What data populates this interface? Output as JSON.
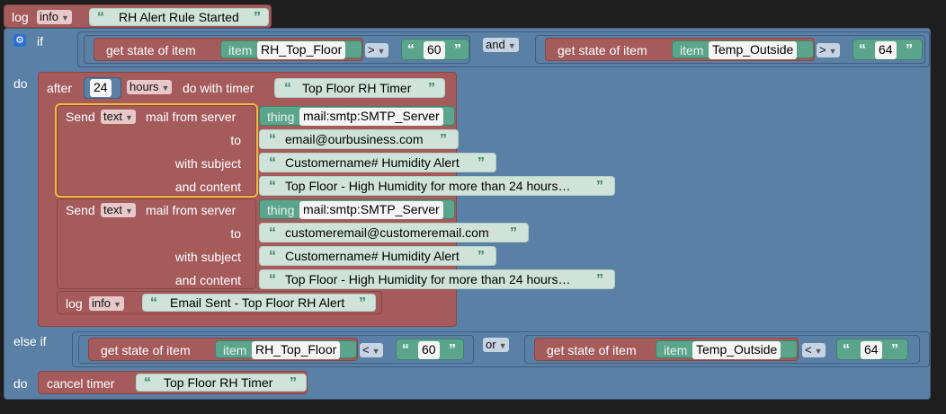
{
  "log1": {
    "label": "log",
    "level": "info",
    "text": "RH Alert Rule Started"
  },
  "if_block": {
    "if_label": "if",
    "else_if_label": "else if",
    "do_label": "do",
    "condition1": {
      "left": {
        "get_label": "get state of item",
        "item_label": "item",
        "item_name": "RH_Top_Floor",
        "op": ">",
        "value": "60"
      },
      "joiner": "and",
      "right": {
        "get_label": "get state of item",
        "item_label": "item",
        "item_name": "Temp_Outside",
        "op": ">",
        "value": "64"
      }
    },
    "condition2": {
      "left": {
        "get_label": "get state of item",
        "item_label": "item",
        "item_name": "RH_Top_Floor",
        "op": "<",
        "value": "60"
      },
      "joiner": "or",
      "right": {
        "get_label": "get state of item",
        "item_label": "item",
        "item_name": "Temp_Outside",
        "op": "<",
        "value": "64"
      }
    }
  },
  "timer": {
    "after_label": "after",
    "amount": "24",
    "unit": "hours",
    "do_with_timer_label": "do with timer",
    "timer_name": "Top Floor RH Timer"
  },
  "mail_labels": {
    "send": "Send",
    "format": "text",
    "from_server": "mail from server",
    "thing_label": "thing",
    "to": "to",
    "with_subject": "with subject",
    "and_content": "and content"
  },
  "mail1": {
    "server": "mail:smtp:SMTP_Server",
    "to": "email@ourbusiness.com",
    "subject": "Customername# Humidity Alert",
    "content": "Top Floor - High Humidity for more than 24 hours…"
  },
  "mail2": {
    "server": "mail:smtp:SMTP_Server",
    "to": "customeremail@customeremail.com",
    "subject": "Customername# Humidity Alert",
    "content": "Top Floor - High Humidity for more than 24 hours…"
  },
  "log2": {
    "label": "log",
    "level": "info",
    "text": "Email Sent - Top Floor RH Alert"
  },
  "cancel": {
    "label": "cancel timer",
    "timer_name": "Top Floor RH Timer"
  },
  "glyphs": {
    "open_quote": "“",
    "close_quote": "”",
    "dropdown_arrow": "▼",
    "gear": "⚙"
  }
}
